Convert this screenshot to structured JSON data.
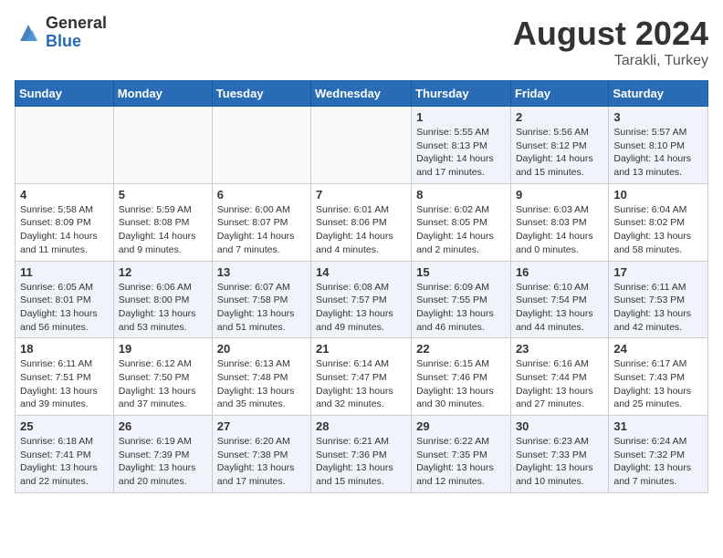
{
  "header": {
    "logo_general": "General",
    "logo_blue": "Blue",
    "month_year": "August 2024",
    "location": "Tarakli, Turkey"
  },
  "days_of_week": [
    "Sunday",
    "Monday",
    "Tuesday",
    "Wednesday",
    "Thursday",
    "Friday",
    "Saturday"
  ],
  "weeks": [
    [
      {
        "day": "",
        "info": ""
      },
      {
        "day": "",
        "info": ""
      },
      {
        "day": "",
        "info": ""
      },
      {
        "day": "",
        "info": ""
      },
      {
        "day": "1",
        "info": "Sunrise: 5:55 AM\nSunset: 8:13 PM\nDaylight: 14 hours\nand 17 minutes."
      },
      {
        "day": "2",
        "info": "Sunrise: 5:56 AM\nSunset: 8:12 PM\nDaylight: 14 hours\nand 15 minutes."
      },
      {
        "day": "3",
        "info": "Sunrise: 5:57 AM\nSunset: 8:10 PM\nDaylight: 14 hours\nand 13 minutes."
      }
    ],
    [
      {
        "day": "4",
        "info": "Sunrise: 5:58 AM\nSunset: 8:09 PM\nDaylight: 14 hours\nand 11 minutes."
      },
      {
        "day": "5",
        "info": "Sunrise: 5:59 AM\nSunset: 8:08 PM\nDaylight: 14 hours\nand 9 minutes."
      },
      {
        "day": "6",
        "info": "Sunrise: 6:00 AM\nSunset: 8:07 PM\nDaylight: 14 hours\nand 7 minutes."
      },
      {
        "day": "7",
        "info": "Sunrise: 6:01 AM\nSunset: 8:06 PM\nDaylight: 14 hours\nand 4 minutes."
      },
      {
        "day": "8",
        "info": "Sunrise: 6:02 AM\nSunset: 8:05 PM\nDaylight: 14 hours\nand 2 minutes."
      },
      {
        "day": "9",
        "info": "Sunrise: 6:03 AM\nSunset: 8:03 PM\nDaylight: 14 hours\nand 0 minutes."
      },
      {
        "day": "10",
        "info": "Sunrise: 6:04 AM\nSunset: 8:02 PM\nDaylight: 13 hours\nand 58 minutes."
      }
    ],
    [
      {
        "day": "11",
        "info": "Sunrise: 6:05 AM\nSunset: 8:01 PM\nDaylight: 13 hours\nand 56 minutes."
      },
      {
        "day": "12",
        "info": "Sunrise: 6:06 AM\nSunset: 8:00 PM\nDaylight: 13 hours\nand 53 minutes."
      },
      {
        "day": "13",
        "info": "Sunrise: 6:07 AM\nSunset: 7:58 PM\nDaylight: 13 hours\nand 51 minutes."
      },
      {
        "day": "14",
        "info": "Sunrise: 6:08 AM\nSunset: 7:57 PM\nDaylight: 13 hours\nand 49 minutes."
      },
      {
        "day": "15",
        "info": "Sunrise: 6:09 AM\nSunset: 7:55 PM\nDaylight: 13 hours\nand 46 minutes."
      },
      {
        "day": "16",
        "info": "Sunrise: 6:10 AM\nSunset: 7:54 PM\nDaylight: 13 hours\nand 44 minutes."
      },
      {
        "day": "17",
        "info": "Sunrise: 6:11 AM\nSunset: 7:53 PM\nDaylight: 13 hours\nand 42 minutes."
      }
    ],
    [
      {
        "day": "18",
        "info": "Sunrise: 6:11 AM\nSunset: 7:51 PM\nDaylight: 13 hours\nand 39 minutes."
      },
      {
        "day": "19",
        "info": "Sunrise: 6:12 AM\nSunset: 7:50 PM\nDaylight: 13 hours\nand 37 minutes."
      },
      {
        "day": "20",
        "info": "Sunrise: 6:13 AM\nSunset: 7:48 PM\nDaylight: 13 hours\nand 35 minutes."
      },
      {
        "day": "21",
        "info": "Sunrise: 6:14 AM\nSunset: 7:47 PM\nDaylight: 13 hours\nand 32 minutes."
      },
      {
        "day": "22",
        "info": "Sunrise: 6:15 AM\nSunset: 7:46 PM\nDaylight: 13 hours\nand 30 minutes."
      },
      {
        "day": "23",
        "info": "Sunrise: 6:16 AM\nSunset: 7:44 PM\nDaylight: 13 hours\nand 27 minutes."
      },
      {
        "day": "24",
        "info": "Sunrise: 6:17 AM\nSunset: 7:43 PM\nDaylight: 13 hours\nand 25 minutes."
      }
    ],
    [
      {
        "day": "25",
        "info": "Sunrise: 6:18 AM\nSunset: 7:41 PM\nDaylight: 13 hours\nand 22 minutes."
      },
      {
        "day": "26",
        "info": "Sunrise: 6:19 AM\nSunset: 7:39 PM\nDaylight: 13 hours\nand 20 minutes."
      },
      {
        "day": "27",
        "info": "Sunrise: 6:20 AM\nSunset: 7:38 PM\nDaylight: 13 hours\nand 17 minutes."
      },
      {
        "day": "28",
        "info": "Sunrise: 6:21 AM\nSunset: 7:36 PM\nDaylight: 13 hours\nand 15 minutes."
      },
      {
        "day": "29",
        "info": "Sunrise: 6:22 AM\nSunset: 7:35 PM\nDaylight: 13 hours\nand 12 minutes."
      },
      {
        "day": "30",
        "info": "Sunrise: 6:23 AM\nSunset: 7:33 PM\nDaylight: 13 hours\nand 10 minutes."
      },
      {
        "day": "31",
        "info": "Sunrise: 6:24 AM\nSunset: 7:32 PM\nDaylight: 13 hours\nand 7 minutes."
      }
    ]
  ]
}
